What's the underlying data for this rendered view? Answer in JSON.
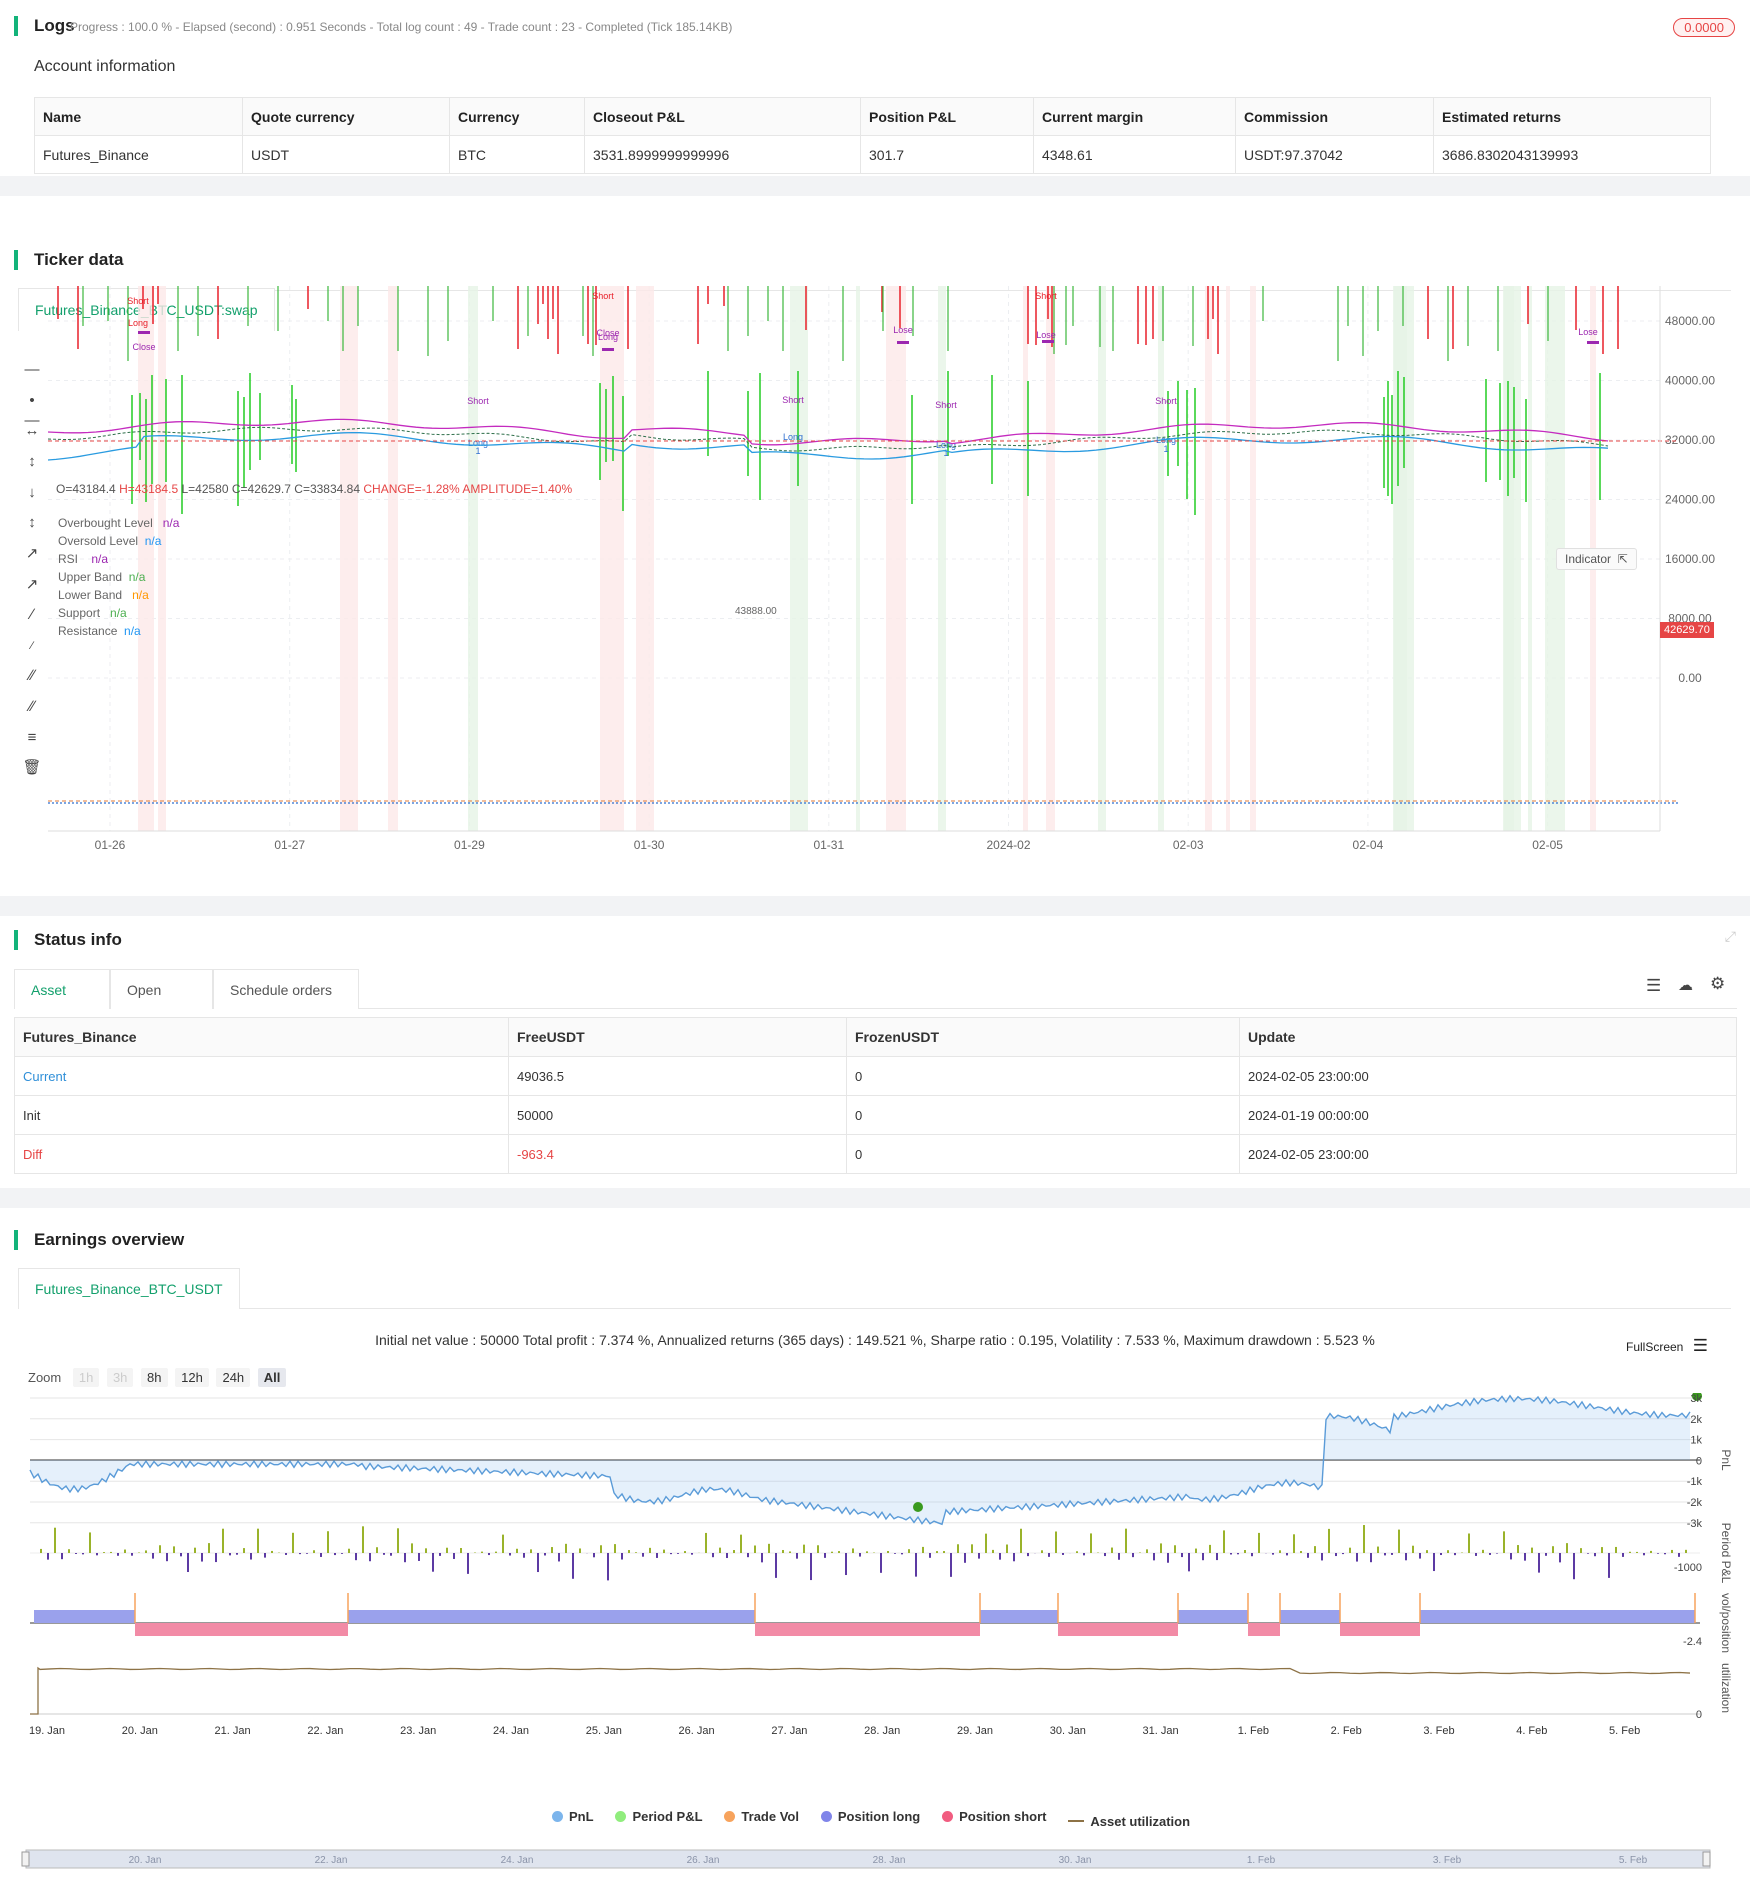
{
  "logs": {
    "title": "Logs",
    "status_line": "Progress : 100.0 % - Elapsed (second) : 0.951 Seconds - Total log count : 49 - Trade count : 23 - Completed (Tick 185.14KB)",
    "badge": "0.0000"
  },
  "account": {
    "title": "Account information",
    "headers": [
      "Name",
      "Quote currency",
      "Currency",
      "Closeout P&L",
      "Position P&L",
      "Current margin",
      "Commission",
      "Estimated returns"
    ],
    "row": [
      "Futures_Binance",
      "USDT",
      "BTC",
      "3531.8999999999996",
      "301.7",
      "4348.61",
      "USDT:97.37042",
      "3686.8302043139993"
    ]
  },
  "ticker": {
    "title": "Ticker data",
    "tab": "Futures_Binance_BTC_USDT:swap",
    "ohlc": {
      "o": "O=43184.4",
      "h": "H=43184.5",
      "l": "L=42580",
      "c": "C=42629.7",
      "c2": "C=33834.84",
      "change": "CHANGE=-1.28%",
      "amp": "AMPLITUDE=1.40%"
    },
    "legend": [
      {
        "label": "Overbought Level",
        "value": "n/a",
        "color": "#9c27b0"
      },
      {
        "label": "Oversold Level",
        "value": "n/a",
        "color": "#2196f3"
      },
      {
        "label": "RSI",
        "value": "n/a",
        "color": "#9c27b0"
      },
      {
        "label": "Upper Band",
        "value": "n/a",
        "color": "#4caf50"
      },
      {
        "label": "Lower Band",
        "value": "n/a",
        "color": "#ff9800"
      },
      {
        "label": "Support",
        "value": "n/a",
        "color": "#4caf50"
      },
      {
        "label": "Resistance",
        "value": "n/a",
        "color": "#2196f3"
      }
    ],
    "indicator_btn": "Indicator",
    "price_tag": "42629.70",
    "mark_label": "43888.00",
    "y_ticks": [
      "48000.00",
      "40000.00",
      "32000.00",
      "24000.00",
      "16000.00",
      "8000.00",
      "0.00"
    ],
    "x_ticks": [
      "01-26",
      "01-27",
      "01-29",
      "01-30",
      "01-31",
      "2024-02",
      "02-03",
      "02-04",
      "02-05"
    ],
    "trade_labels": {
      "short": "Short",
      "long": "Long",
      "close": "Close",
      "lose": "Lose",
      "one": "1"
    }
  },
  "status": {
    "title": "Status info",
    "tabs": [
      "Asset",
      "Open orders",
      "Schedule orders"
    ],
    "headers": [
      "Futures_Binance",
      "FreeUSDT",
      "FrozenUSDT",
      "Update"
    ],
    "rows": [
      {
        "name": "Current",
        "free": "49036.5",
        "frozen": "0",
        "update": "2024-02-05 23:00:00"
      },
      {
        "name": "Init",
        "free": "50000",
        "frozen": "0",
        "update": "2024-01-19 00:00:00"
      },
      {
        "name": "Diff",
        "free": "-963.4",
        "frozen": "0",
        "update": "2024-02-05 23:00:00"
      }
    ]
  },
  "earnings": {
    "title": "Earnings overview",
    "tab": "Futures_Binance_BTC_USDT",
    "summary": "Initial net value : 50000 Total profit : 7.374 %, Annualized returns (365 days) : 149.521 %, Sharpe ratio : 0.195, Volatility : 7.533 %, Maximum drawdown : 5.523 %",
    "fullscreen": "FullScreen",
    "zoom_label": "Zoom",
    "zoom": [
      "1h",
      "3h",
      "8h",
      "12h",
      "24h",
      "All"
    ],
    "pnl_ticks": [
      "3k",
      "2k",
      "1k",
      "0",
      "-1k",
      "-2k",
      "-3k"
    ],
    "period_tick": "-1000",
    "pos_tick": "-2.4",
    "util_tick": "0",
    "axis_labels": {
      "pnl": "PnL",
      "period": "Period P&L",
      "pos": "vol/position",
      "util": "utilization"
    },
    "x_ticks": [
      "19. Jan",
      "20. Jan",
      "21. Jan",
      "22. Jan",
      "23. Jan",
      "24. Jan",
      "25. Jan",
      "26. Jan",
      "27. Jan",
      "28. Jan",
      "29. Jan",
      "30. Jan",
      "31. Jan",
      "1. Feb",
      "2. Feb",
      "3. Feb",
      "4. Feb",
      "5. Feb"
    ],
    "nav_ticks": [
      "20. Jan",
      "22. Jan",
      "24. Jan",
      "26. Jan",
      "28. Jan",
      "30. Jan",
      "1. Feb",
      "3. Feb",
      "5. Feb"
    ],
    "legend": [
      {
        "label": "PnL",
        "color": "#7cb5ec"
      },
      {
        "label": "Period P&L",
        "color": "#90ed7d"
      },
      {
        "label": "Trade Vol",
        "color": "#f7a35c"
      },
      {
        "label": "Position long",
        "color": "#8085e9"
      },
      {
        "label": "Position short",
        "color": "#f15c80"
      },
      {
        "label": "Asset utilization",
        "color": "#8d7246"
      }
    ]
  }
}
